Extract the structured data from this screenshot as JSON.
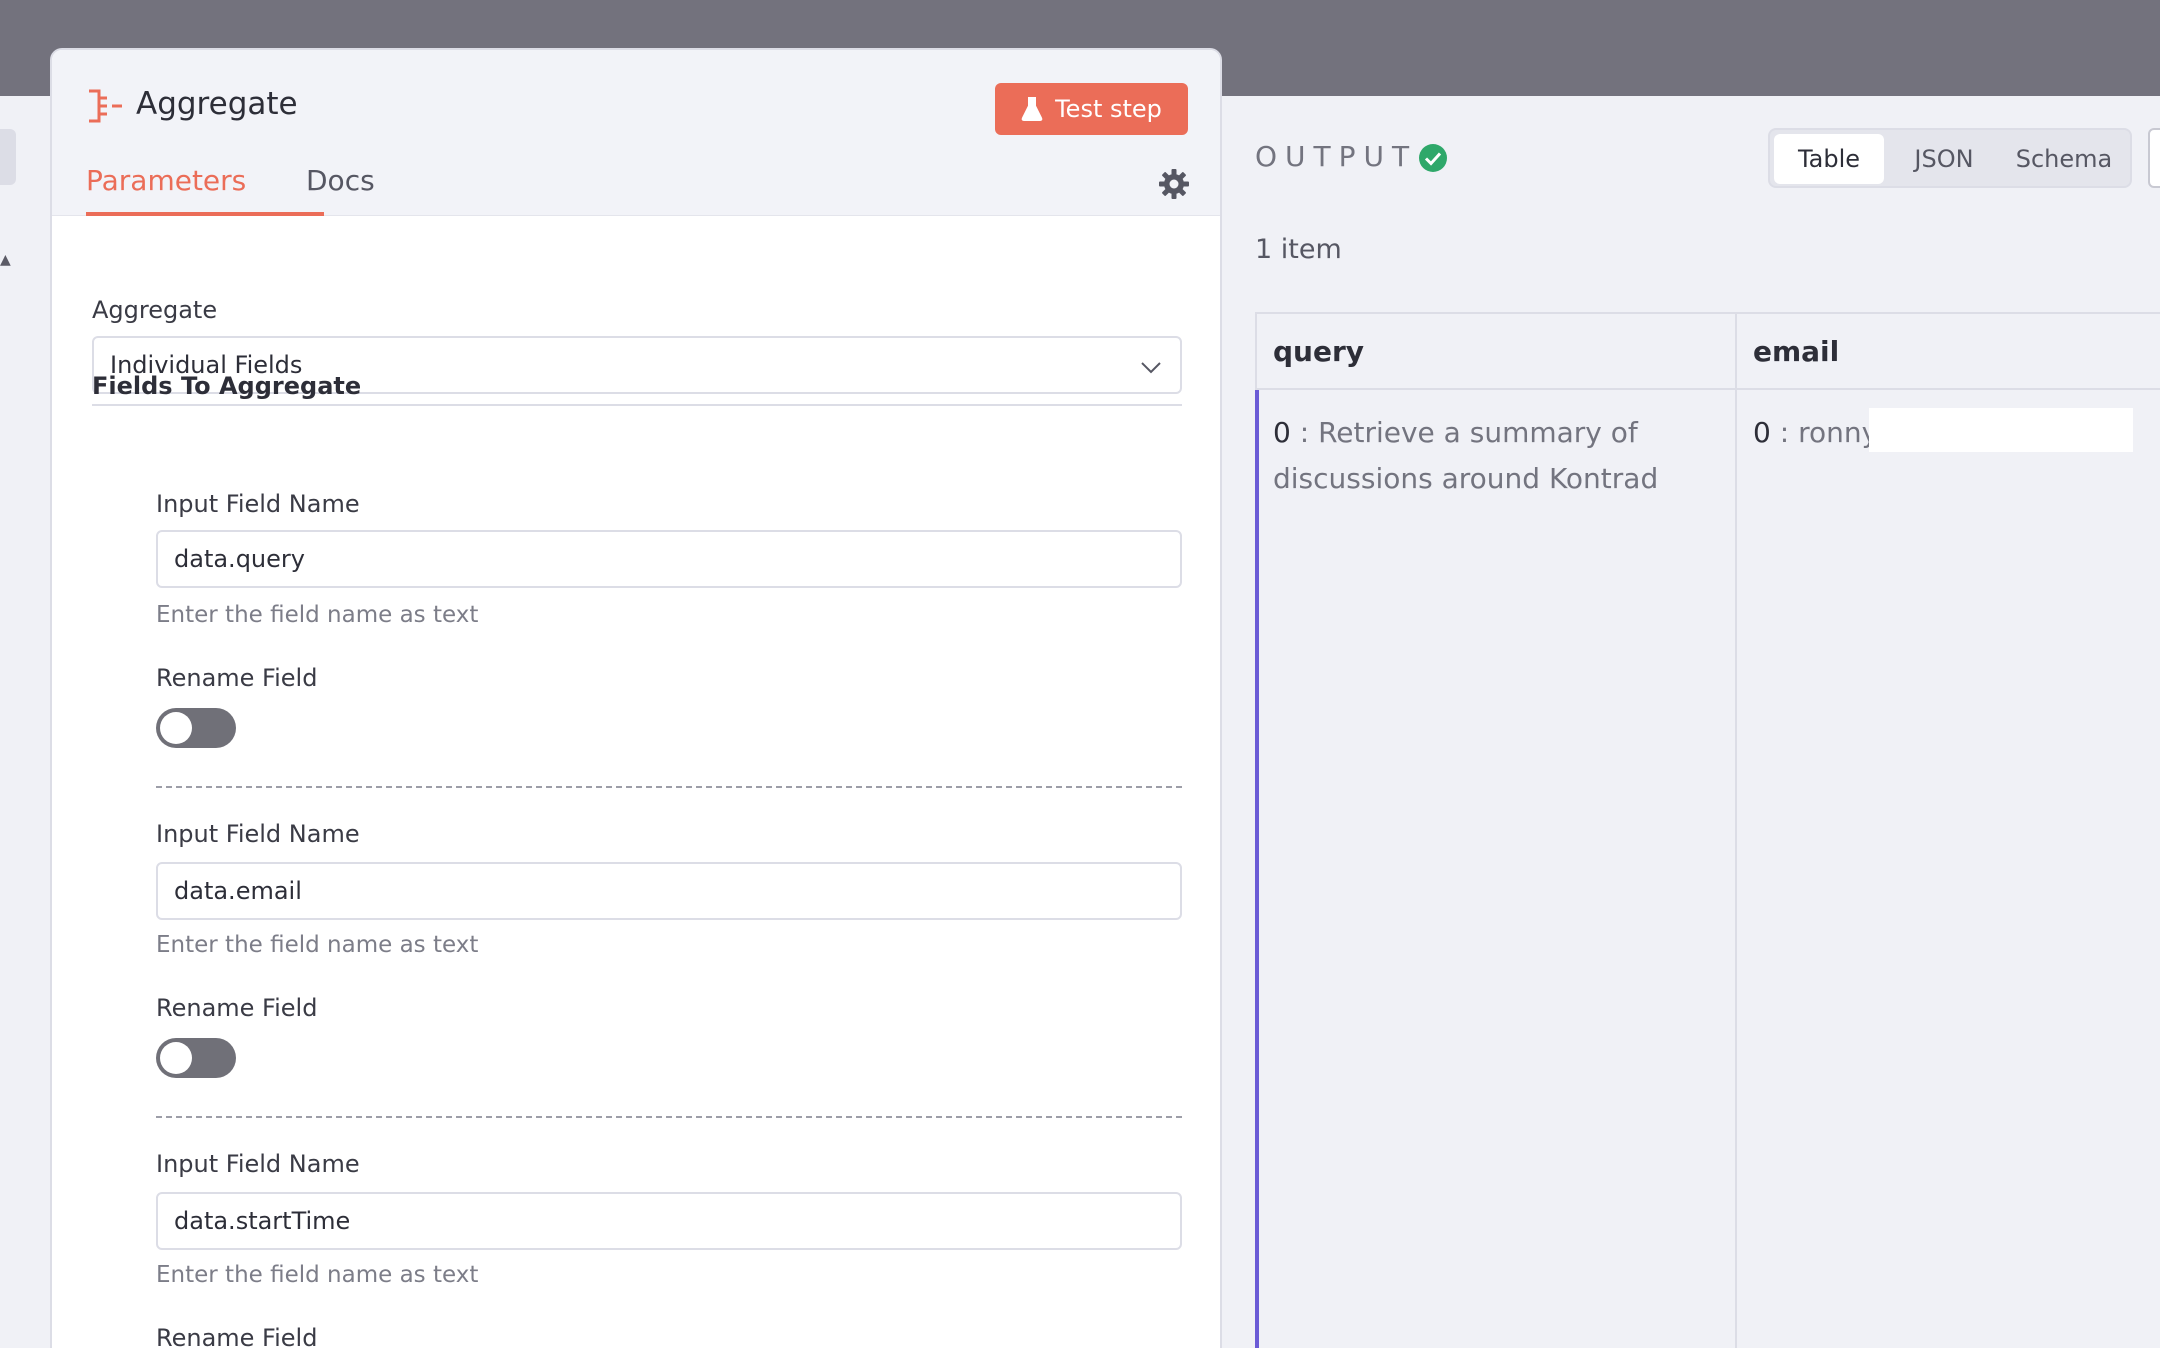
{
  "node": {
    "title": "Aggregate",
    "test_button": "Test step",
    "tabs": [
      "Parameters",
      "Docs"
    ]
  },
  "params": {
    "aggregate_label": "Aggregate",
    "aggregate_value": "Individual Fields",
    "section_title": "Fields To Aggregate",
    "fields": [
      {
        "label": "Input Field Name",
        "value": "data.query",
        "hint": "Enter the field name as text",
        "rename_label": "Rename Field",
        "rename_on": false
      },
      {
        "label": "Input Field Name",
        "value": "data.email",
        "hint": "Enter the field name as text",
        "rename_label": "Rename Field",
        "rename_on": false
      },
      {
        "label": "Input Field Name",
        "value": "data.startTime",
        "hint": "Enter the field name as text",
        "rename_label": "Rename Field",
        "rename_on": false
      }
    ]
  },
  "output": {
    "label": "OUTPUT",
    "views": [
      "Table",
      "JSON",
      "Schema"
    ],
    "active_view": "Table",
    "item_count": "1 item",
    "columns": [
      "query",
      "email"
    ],
    "rows": [
      {
        "query_index": "0",
        "query": "Retrieve a summary of discussions around Kontrad",
        "email_index": "0",
        "email": "ronny"
      }
    ]
  },
  "colors": {
    "accent": "#eb6d58",
    "success": "#2fa86a",
    "row_accent": "#6b5bd6",
    "topbar": "#73727d"
  }
}
